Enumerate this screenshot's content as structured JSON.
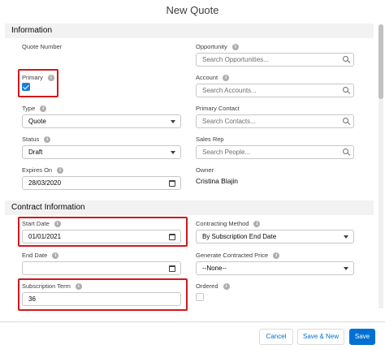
{
  "modal": {
    "title": "New Quote"
  },
  "sections": {
    "information": "Information",
    "contract": "Contract Information"
  },
  "fields": {
    "quote_number": {
      "label": "Quote Number"
    },
    "opportunity": {
      "label": "Opportunity",
      "placeholder": "Search Opportunities..."
    },
    "primary": {
      "label": "Primary",
      "checked": true
    },
    "account": {
      "label": "Account",
      "placeholder": "Search Accounts..."
    },
    "type": {
      "label": "Type",
      "value": "Quote"
    },
    "primary_contact": {
      "label": "Primary Contact",
      "placeholder": "Search Contacts..."
    },
    "status": {
      "label": "Status",
      "value": "Draft"
    },
    "sales_rep": {
      "label": "Sales Rep",
      "placeholder": "Search People..."
    },
    "expires_on": {
      "label": "Expires On",
      "value": "28/03/2020"
    },
    "owner": {
      "label": "Owner",
      "value": "Cristina Blajin"
    },
    "start_date": {
      "label": "Start Date",
      "value": "01/01/2021"
    },
    "contracting_method": {
      "label": "Contracting Method",
      "value": "By Subscription End Date"
    },
    "end_date": {
      "label": "End Date",
      "value": ""
    },
    "generate_contracted_price": {
      "label": "Generate Contracted Price",
      "value": "--None--"
    },
    "subscription_term": {
      "label": "Subscription Term",
      "value": "36"
    },
    "ordered": {
      "label": "Ordered",
      "checked": false
    }
  },
  "footer": {
    "cancel": "Cancel",
    "save_new": "Save & New",
    "save": "Save"
  },
  "colors": {
    "brand": "#0070d2",
    "highlight": "#d0191d",
    "section_bg": "#f3f2f2"
  },
  "icons": {
    "info": "i",
    "search": "search-icon",
    "calendar": "calendar-icon",
    "dropdown": "chevron-down-icon"
  }
}
